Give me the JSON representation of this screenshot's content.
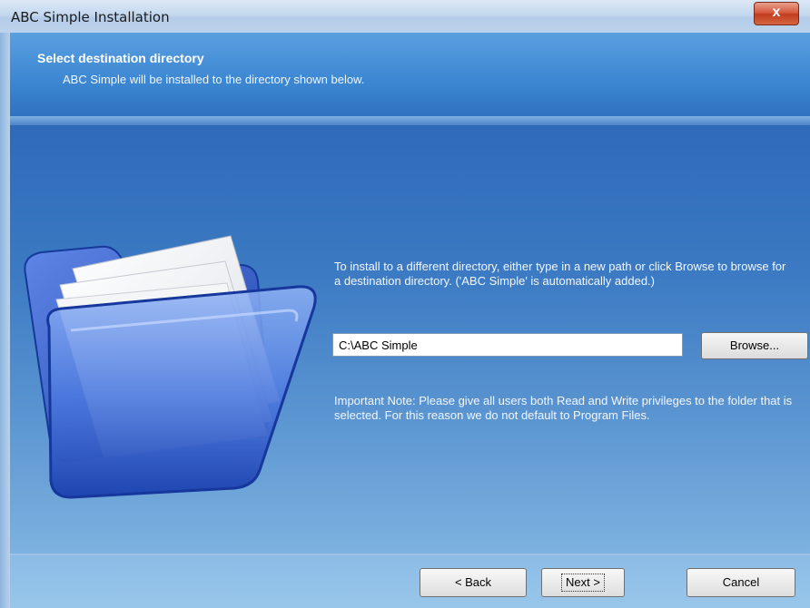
{
  "window": {
    "title": "ABC Simple Installation",
    "close_glyph": "x"
  },
  "header": {
    "title": "Select destination directory",
    "subtitle": "ABC Simple will be installed to the directory shown below."
  },
  "main": {
    "instruction": "To install to a different directory, either type in a new path or click Browse to browse for a destination directory. ('ABC Simple' is automatically added.)",
    "path_value": "C:\\ABC Simple",
    "browse_label": "Browse...",
    "note": "Important Note:  Please give all users both Read and Write privileges to the folder that is selected.  For this reason we do not default to Program Files."
  },
  "footer": {
    "back_label": "< Back",
    "next_label": "Next >",
    "cancel_label": "Cancel"
  },
  "icons": {
    "folder": "open-folder-icon",
    "close": "close-icon"
  },
  "colors": {
    "content_bg": "#3c7ac3",
    "header_bg": "#3c86d2",
    "close_button": "#d4553a"
  }
}
